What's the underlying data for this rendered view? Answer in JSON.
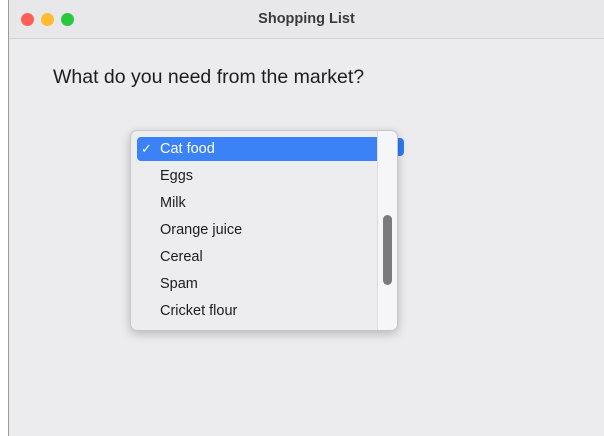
{
  "window": {
    "title": "Shopping List"
  },
  "traffic_lights": {
    "close_color": "#ff5f57",
    "minimize_color": "#febc2e",
    "zoom_color": "#28c840"
  },
  "main": {
    "prompt": "What do you need from the market?"
  },
  "menu": {
    "check_glyph": "✓",
    "selected_index": 0,
    "accent_color": "#3b82f6",
    "items": [
      {
        "label": "Cat food",
        "selected": true
      },
      {
        "label": "Eggs",
        "selected": false
      },
      {
        "label": "Milk",
        "selected": false
      },
      {
        "label": "Orange juice",
        "selected": false
      },
      {
        "label": "Cereal",
        "selected": false
      },
      {
        "label": "Spam",
        "selected": false
      },
      {
        "label": "Cricket flour",
        "selected": false
      }
    ],
    "scrollbar": {
      "visible": true
    }
  }
}
